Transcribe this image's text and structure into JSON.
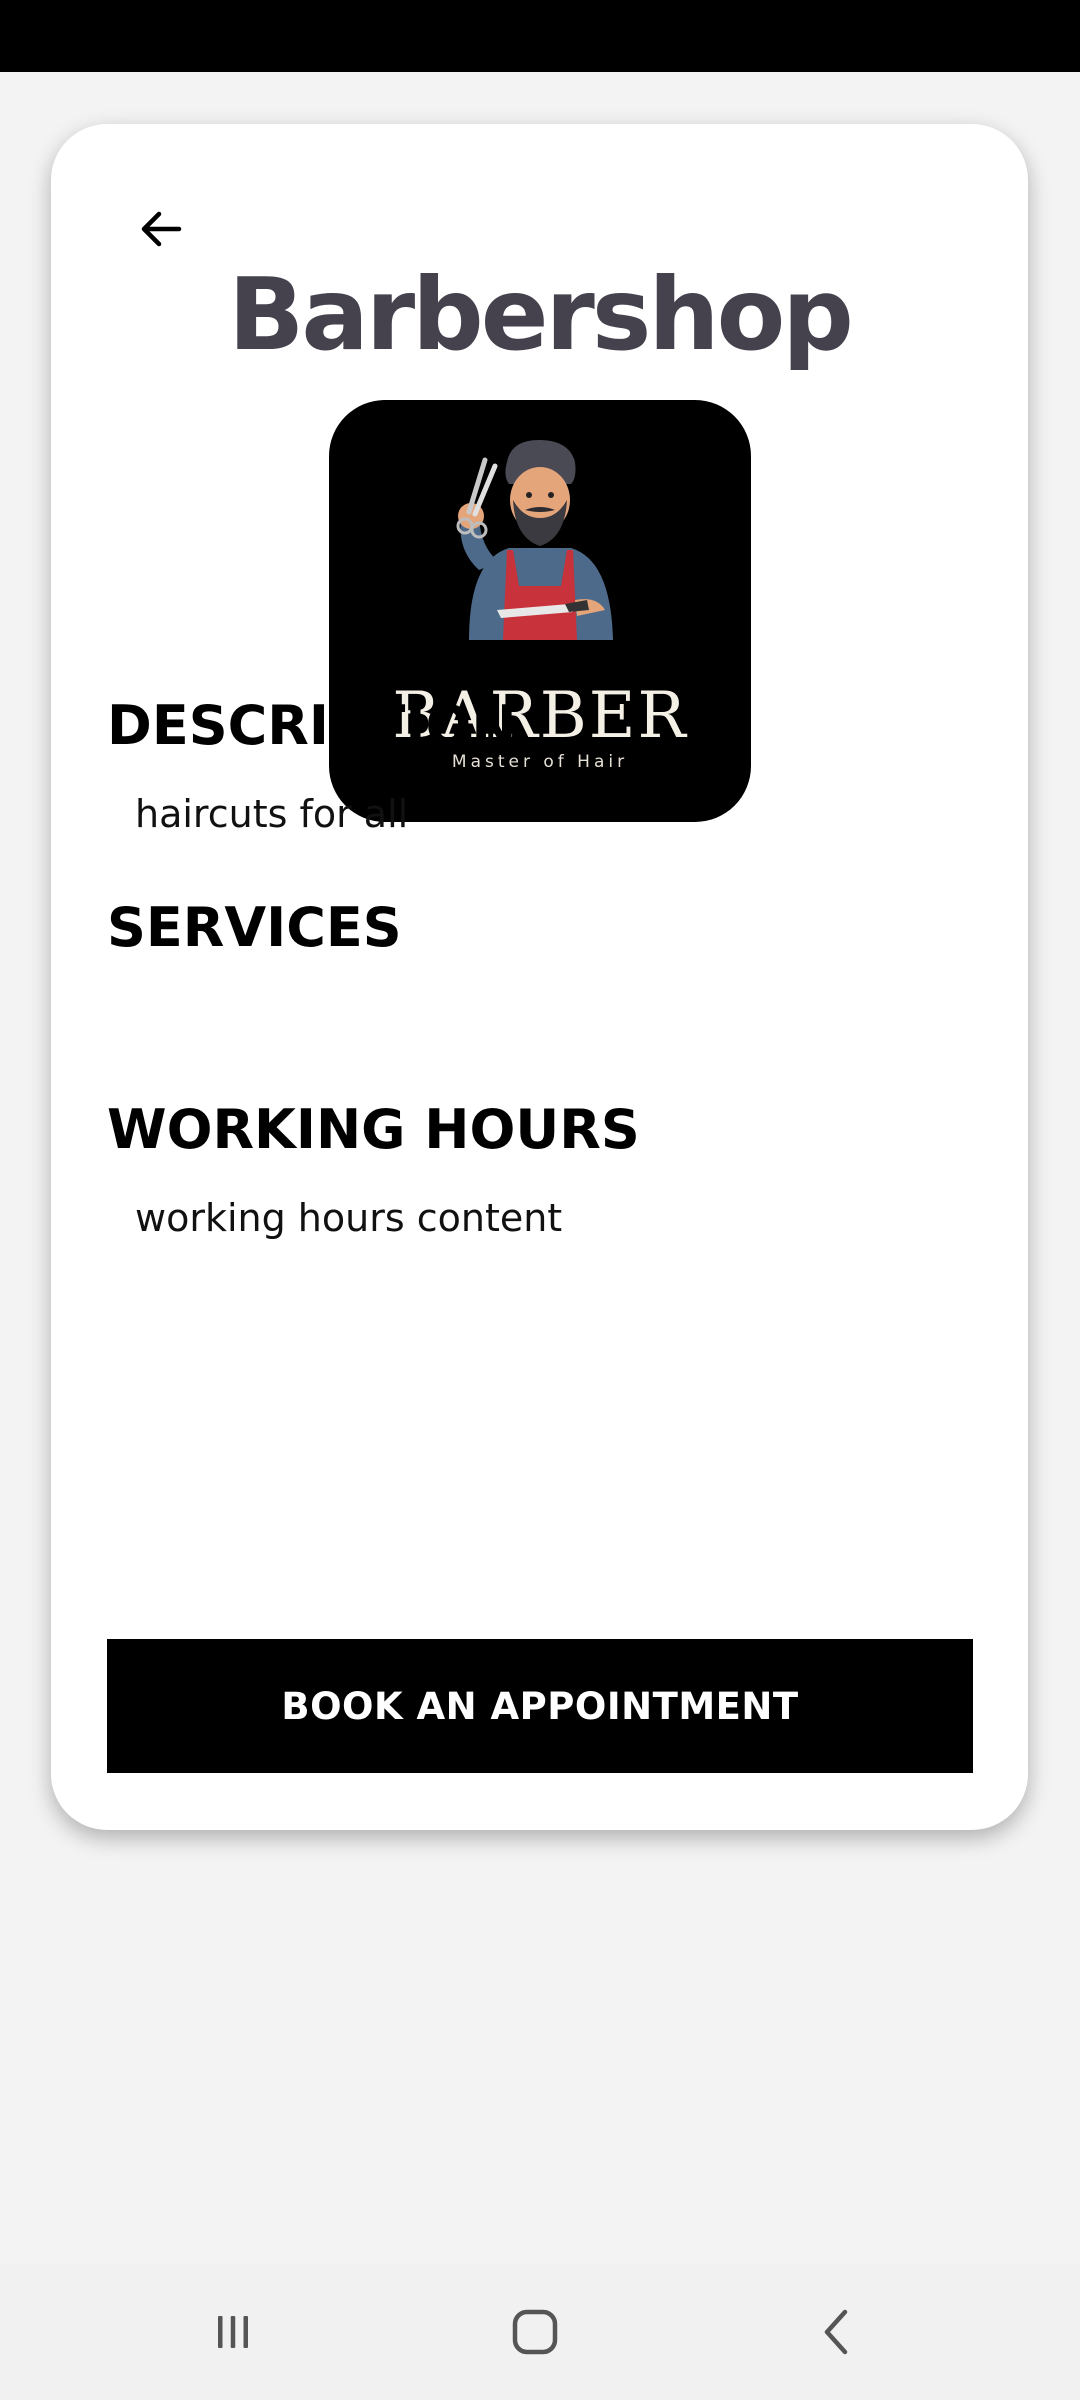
{
  "shop": {
    "title": "Barbershop",
    "logo": {
      "brand": "BARBER",
      "tagline": "Master of Hair"
    }
  },
  "sections": {
    "description": {
      "heading": "DESCRIPTION",
      "text": "haircuts for all"
    },
    "services": {
      "heading": "SERVICES",
      "text": ""
    },
    "working_hours": {
      "heading": "WORKING HOURS",
      "text": "working hours content"
    }
  },
  "actions": {
    "book_label": "BOOK AN APPOINTMENT"
  },
  "icons": {
    "back": "arrow-left-icon",
    "nav_recents": "recents-icon",
    "nav_home": "home-icon",
    "nav_back": "chevron-left-icon"
  },
  "colors": {
    "title": "#45424e",
    "button_bg": "#000000",
    "button_text": "#ffffff",
    "card_bg": "#ffffff",
    "page_bg": "#f3f3f3"
  }
}
